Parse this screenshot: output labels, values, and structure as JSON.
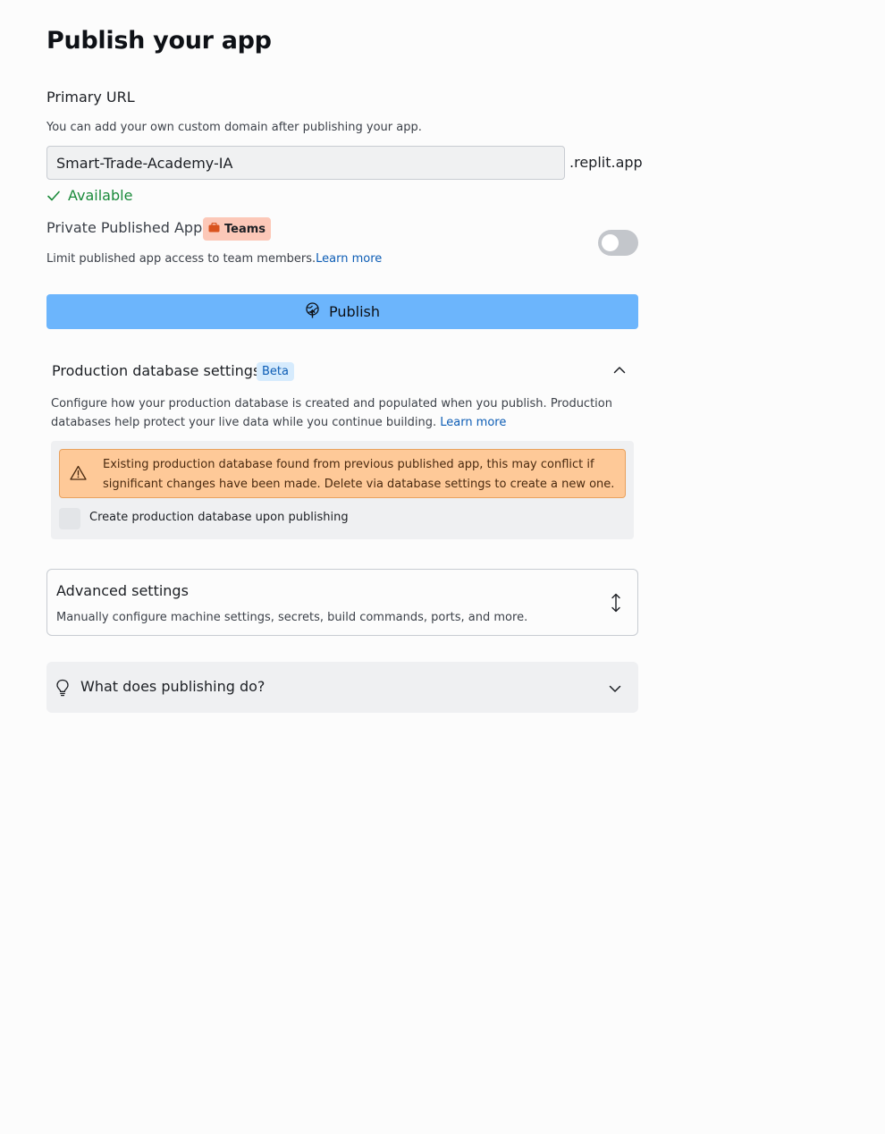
{
  "page": {
    "title": "Publish your app"
  },
  "primary_url": {
    "label": "Primary URL",
    "help": "You can add your own custom domain after publishing your app.",
    "value": "Smart-Trade-Academy-IA",
    "suffix": ".replit.app",
    "status": "Available",
    "status_color": "#1a8a3a"
  },
  "private_app": {
    "label": "Private Published App",
    "badge": "Teams",
    "badge_icon": "briefcase-icon",
    "help": "Limit published app access to team members.",
    "learn_more": "Learn more",
    "toggle_on": false
  },
  "publish": {
    "label": "Publish",
    "icon": "publish-globe-icon",
    "color": "#6cb5fc"
  },
  "production_db": {
    "title": "Production database settings",
    "badge": "Beta",
    "description": "Configure how your production database is created and populated when you publish. Production databases help protect your live data while you continue building.",
    "learn_more": "Learn more",
    "warning": "Existing production database found from previous published app, this may conflict if significant changes have been made. Delete via database settings to create a new one.",
    "warning_icon": "warning-triangle-icon",
    "checkbox_label": "Create production database upon publishing",
    "checkbox_checked": false
  },
  "advanced": {
    "title": "Advanced settings",
    "description": "Manually configure machine settings, secrets, build commands, ports, and more.",
    "icon": "expand-vertical-icon"
  },
  "faq": {
    "title": "What does publishing do?",
    "icon": "lightbulb-icon"
  },
  "colors": {
    "link": "#0d5db5",
    "warning_bg": "#fec998",
    "teams_badge_bg": "#fcc8b8",
    "beta_badge_bg": "#d6ebfd"
  }
}
